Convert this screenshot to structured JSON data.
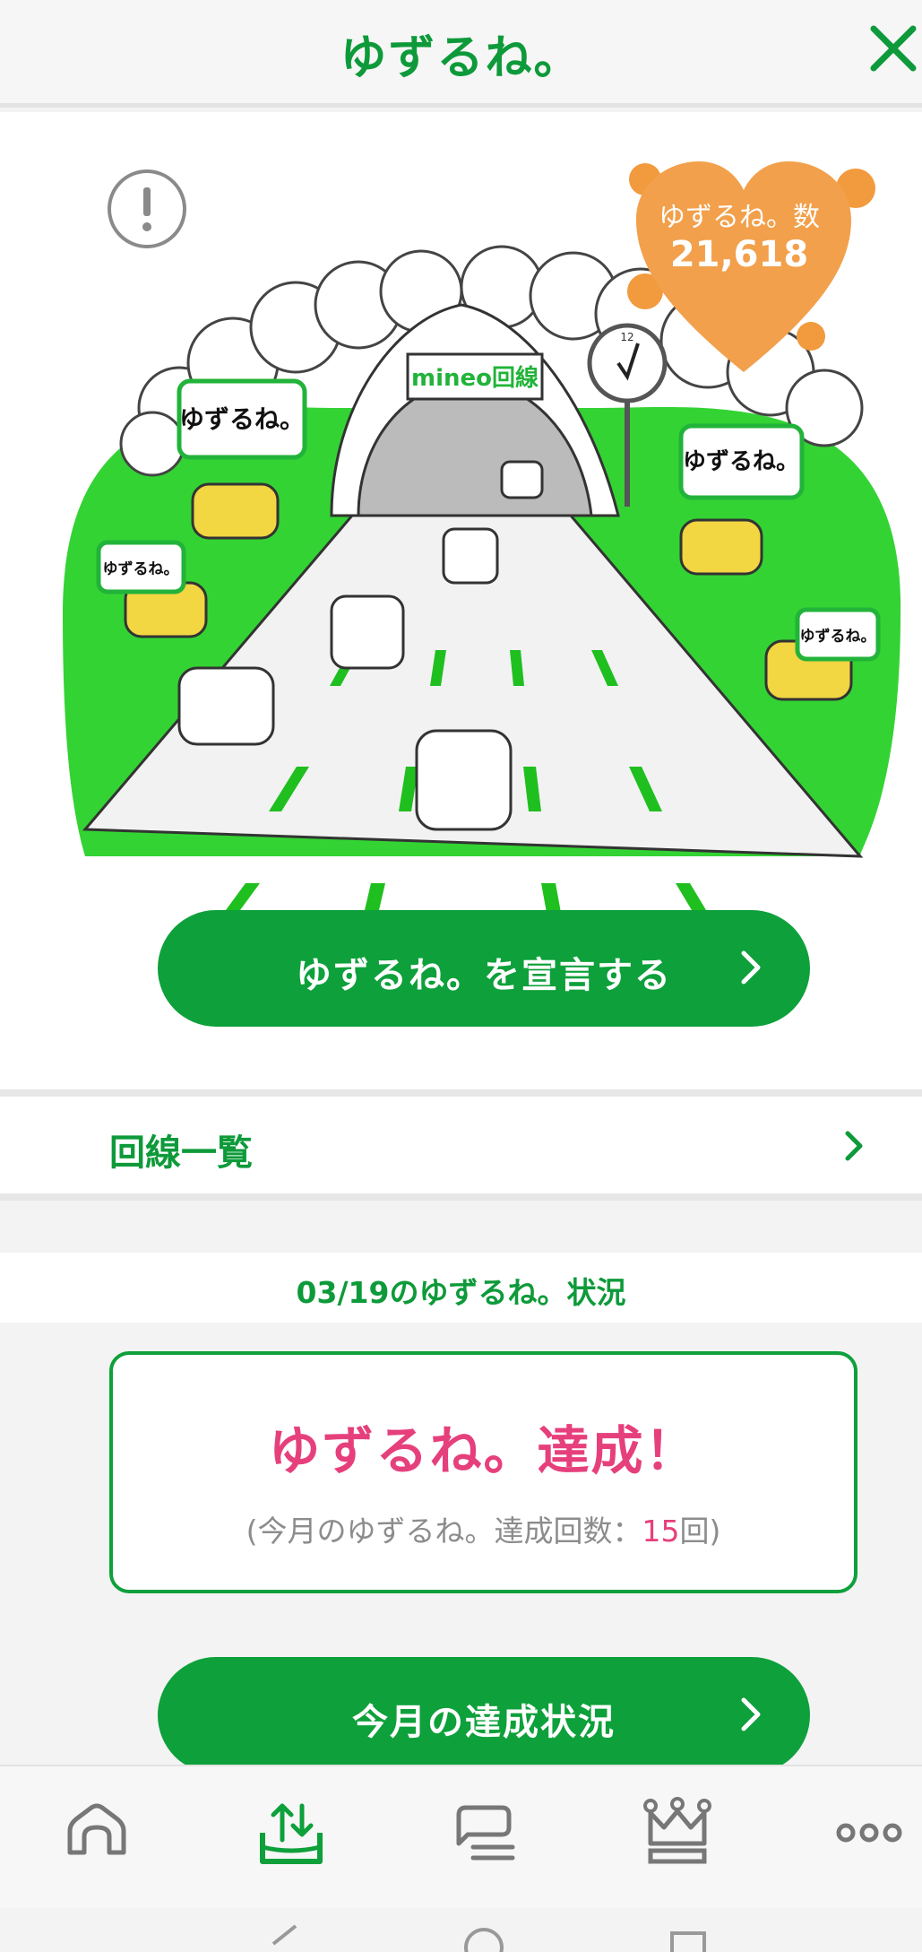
{
  "header": {
    "title": "ゆずるね。"
  },
  "hero": {
    "badge_label": "ゆずるね。数",
    "badge_count": "21,618",
    "sign_text": "mineo回線",
    "speech_bubble": "ゆずるね。",
    "clock_label": "12"
  },
  "declare_button": {
    "label": "ゆずるね。を宣言する"
  },
  "line_list": {
    "label": "回線一覧"
  },
  "status": {
    "date_title": "03/19のゆずるね。状況",
    "achieved": "ゆずるね。達成！",
    "count_prefix": "(今月のゆずるね。達成回数：",
    "count": "15",
    "count_suffix": "回)"
  },
  "monthly_button": {
    "label": "今月の達成状況"
  },
  "tabbar": {
    "tabs": [
      {
        "icon": "home-icon",
        "active": false
      },
      {
        "icon": "share-upload-icon",
        "active": true
      },
      {
        "icon": "chat-icon",
        "active": false
      },
      {
        "icon": "crown-icon",
        "active": false
      },
      {
        "icon": "more-icon",
        "active": false
      }
    ]
  },
  "colors": {
    "brand_green": "#0ea03b",
    "accent_pink": "#e6407c",
    "badge_orange": "#f2a04b"
  }
}
